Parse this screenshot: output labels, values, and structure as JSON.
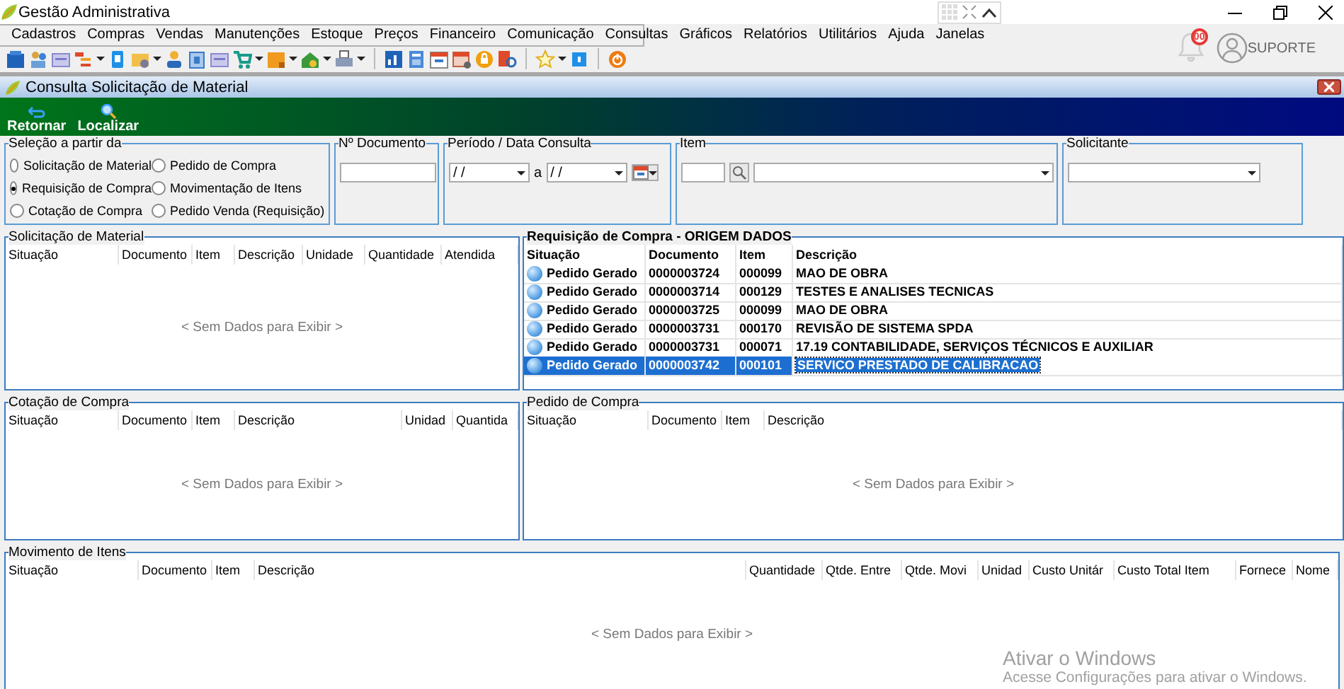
{
  "window": {
    "title": "Gestão Administrativa"
  },
  "menu": [
    "Cadastros",
    "Compras",
    "Vendas",
    "Manutenções",
    "Estoque",
    "Preços",
    "Financeiro",
    "Comunicação",
    "Consultas",
    "Gráficos",
    "Relatórios",
    "Utilitários",
    "Ajuda",
    "Janelas"
  ],
  "notifications": {
    "badge": "00"
  },
  "user": {
    "name": "SUPORTE"
  },
  "child_window": {
    "title": "Consulta Solicitação de Material"
  },
  "actions": [
    {
      "label": "Retornar",
      "kind": "back"
    },
    {
      "label": "Localizar",
      "kind": "search"
    }
  ],
  "filters": {
    "selection": {
      "legend": "Seleção a partir da",
      "options": [
        {
          "label": "Solicitação de Material",
          "selected": false
        },
        {
          "label": "Requisição de Compra",
          "selected": true
        },
        {
          "label": "Cotação de Compra",
          "selected": false
        },
        {
          "label": "Pedido de Compra",
          "selected": false
        },
        {
          "label": "Movimentação de Itens",
          "selected": false
        },
        {
          "label": "Pedido Venda (Requisição)",
          "selected": false
        }
      ]
    },
    "document": {
      "legend": "Nº Documento"
    },
    "period": {
      "legend": "Período / Data Consulta",
      "from": "/ /",
      "separator": "a",
      "to": "/ /"
    },
    "item": {
      "legend": "Item"
    },
    "requester": {
      "legend": "Solicitante"
    }
  },
  "panel_rows": [
    [
      {
        "title": "Solicitação de Material",
        "highlighted": false,
        "columns": [
          "Situação",
          "Documento",
          "Item",
          "Descrição",
          "Unidade",
          "Quantidade",
          "Atendida"
        ],
        "empty_text": "< Sem Dados para Exibir >"
      },
      {
        "title": "Requisição de Compra - ORIGEM DADOS",
        "highlighted": true,
        "columns": [
          "Situação",
          "Documento",
          "Item",
          "Descrição"
        ],
        "rows": [
          {
            "cells": [
              "Pedido Gerado",
              "0000003724",
              "000099",
              "MAO DE OBRA"
            ],
            "selected": false
          },
          {
            "cells": [
              "Pedido Gerado",
              "0000003714",
              "000129",
              "TESTES E ANALISES TECNICAS"
            ],
            "selected": false
          },
          {
            "cells": [
              "Pedido Gerado",
              "0000003725",
              "000099",
              "MAO DE OBRA"
            ],
            "selected": false
          },
          {
            "cells": [
              "Pedido Gerado",
              "0000003731",
              "000170",
              "REVISÃO DE SISTEMA SPDA"
            ],
            "selected": false
          },
          {
            "cells": [
              "Pedido Gerado",
              "0000003731",
              "000071",
              "17.19 CONTABILIDADE, SERVIÇOS TÉCNICOS E AUXILIAR"
            ],
            "selected": false
          },
          {
            "cells": [
              "Pedido Gerado",
              "0000003742",
              "000101",
              "SERVICO PRESTADO DE CALIBRACAO"
            ],
            "selected": true
          }
        ]
      }
    ],
    [
      {
        "title": "Cotação de Compra",
        "highlighted": false,
        "columns": [
          "Situação",
          "Documento",
          "Item",
          "Descrição",
          "Unidad",
          "Quantida"
        ],
        "empty_text": "< Sem Dados para Exibir >"
      },
      {
        "title": "Pedido de Compra",
        "highlighted": false,
        "columns": [
          "Situação",
          "Documento",
          "Item",
          "Descrição"
        ],
        "empty_text": "< Sem Dados para Exibir >"
      }
    ],
    [
      {
        "title": "Movimento de Itens",
        "highlighted": false,
        "columns": [
          "Situação",
          "Documento",
          "Item",
          "Descrição",
          "Quantidade",
          "Qtde. Entre",
          "Qtde. Movi",
          "Unidad",
          "Custo Unitár",
          "Custo Total Item",
          "Fornece",
          "Nome"
        ],
        "empty_text": "< Sem Dados para Exibir >"
      }
    ]
  ],
  "os_notice": {
    "title": "Ativar o Windows",
    "text": "Acesse Configurações para ativar o Windows."
  }
}
